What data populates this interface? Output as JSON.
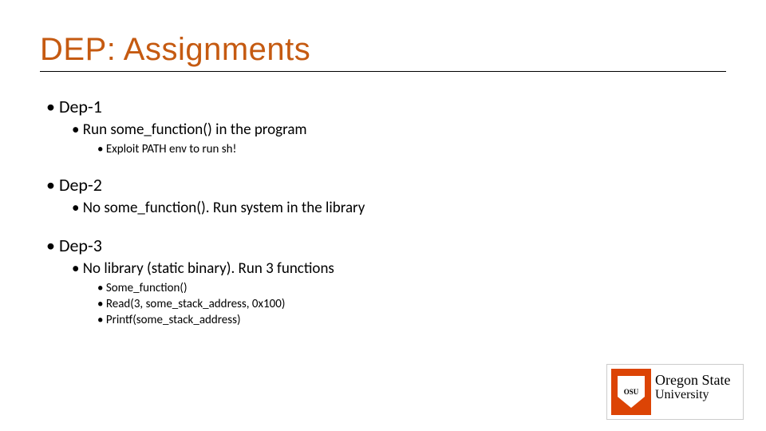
{
  "title": "DEP: Assignments",
  "items": [
    {
      "label": "Dep-1",
      "children": [
        {
          "label": "Run some_function() in the program",
          "children": [
            {
              "label": "Exploit PATH env to run sh!"
            }
          ]
        }
      ]
    },
    {
      "label": "Dep-2",
      "children": [
        {
          "label": "No some_function(). Run system in the library"
        }
      ]
    },
    {
      "label": "Dep-3",
      "children": [
        {
          "label": "No library (static binary). Run 3 functions",
          "children": [
            {
              "label": "Some_function()"
            },
            {
              "label": "Read(3, some_stack_address, 0x100)"
            },
            {
              "label": "Printf(some_stack_address)"
            }
          ]
        }
      ]
    }
  ],
  "logo": {
    "line1": "Oregon State",
    "line2": "University",
    "shield": "OSU"
  }
}
